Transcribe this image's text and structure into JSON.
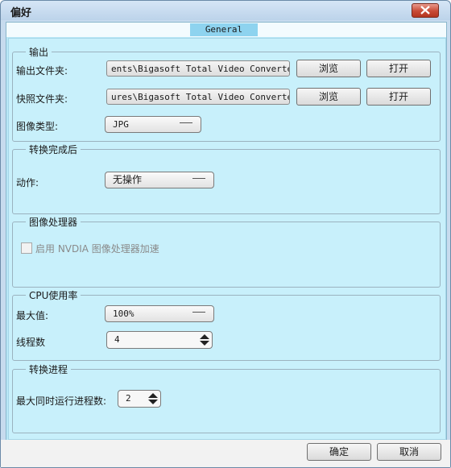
{
  "window": {
    "title": "偏好"
  },
  "tabs": [
    {
      "label": "General"
    }
  ],
  "output": {
    "legend": "输出",
    "folder_label": "输出文件夹:",
    "folder_value": "ents\\Bigasoft Total Video Converter",
    "snapshot_label": "快照文件夹:",
    "snapshot_value": "ures\\Bigasoft Total Video Converter",
    "browse_label": "浏览",
    "open_label": "打开",
    "image_type_label": "图像类型:",
    "image_type_value": "JPG"
  },
  "after_conversion": {
    "legend": "转换完成后",
    "action_label": "动作:",
    "action_value": "无操作"
  },
  "gpu": {
    "legend": "图像处理器",
    "nvidia_checkbox_label": "启用 NVDIA 图像处理器加速",
    "checked": false
  },
  "cpu": {
    "legend": "CPU使用率",
    "max_label": "最大值:",
    "max_value": "100%",
    "threads_label": "线程数",
    "threads_value": "4"
  },
  "process": {
    "legend": "转换进程",
    "max_concurrent_label": "最大同时运行进程数:",
    "max_concurrent_value": "2"
  },
  "footer": {
    "ok_label": "确定",
    "cancel_label": "取消"
  },
  "icons": {
    "close": "close-icon",
    "dropdown": "chevron-down-icon",
    "spin_up": "arrow-up-icon",
    "spin_down": "arrow-down-icon"
  }
}
